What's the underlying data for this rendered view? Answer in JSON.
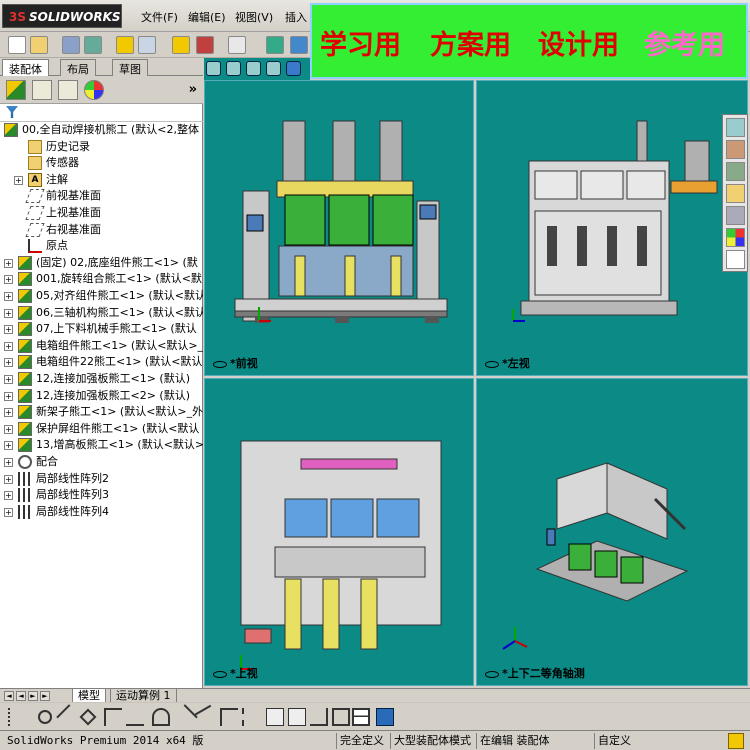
{
  "app": {
    "logo_text": "SOLIDWORKS",
    "menu": [
      "文件(F)",
      "编辑(E)",
      "视图(V)",
      "插入"
    ]
  },
  "banner": {
    "items": [
      {
        "text": "学习用",
        "color": "#e00000"
      },
      {
        "text": "方案用",
        "color": "#e00000"
      },
      {
        "text": "设计用",
        "color": "#e00000"
      },
      {
        "text": "参考用",
        "color": "#ff66cc"
      }
    ],
    "background": "#33ee33"
  },
  "panel": {
    "tabs": [
      "装配体",
      "布局",
      "草图"
    ],
    "active_tab": "装配体",
    "collapse_glyph": "»"
  },
  "tree": [
    {
      "label": "00,全自动焊接机熊工   (默认<2,整体",
      "icon": "assembly",
      "expander": false
    },
    {
      "label": "历史记录",
      "icon": "folder",
      "expander": false
    },
    {
      "label": "传感器",
      "icon": "folder",
      "expander": false
    },
    {
      "label": "注解",
      "icon": "note",
      "expander": true
    },
    {
      "label": "前视基准面",
      "icon": "plane",
      "expander": false
    },
    {
      "label": "上视基准面",
      "icon": "plane",
      "expander": false
    },
    {
      "label": "右视基准面",
      "icon": "plane",
      "expander": false
    },
    {
      "label": "原点",
      "icon": "origin",
      "expander": false
    },
    {
      "label": "(固定) 02,底座组件熊工<1> (默",
      "icon": "assembly",
      "expander": true
    },
    {
      "label": "001,旋转组合熊工<1> (默认<默",
      "icon": "assembly",
      "expander": true
    },
    {
      "label": "05,对齐组件熊工<1> (默认<默认>",
      "icon": "assembly",
      "expander": true
    },
    {
      "label": "06,三轴机构熊工<1> (默认<默认",
      "icon": "assembly",
      "expander": true
    },
    {
      "label": "07,上下料机械手熊工<1> (默认",
      "icon": "assembly",
      "expander": true
    },
    {
      "label": "电箱组件熊工<1> (默认<默认>_",
      "icon": "assembly",
      "expander": true
    },
    {
      "label": "电箱组件22熊工<1> (默认<默认",
      "icon": "assembly",
      "expander": true
    },
    {
      "label": "12,连接加强板熊工<1> (默认)",
      "icon": "assembly",
      "expander": true
    },
    {
      "label": "12,连接加强板熊工<2> (默认)",
      "icon": "assembly",
      "expander": true
    },
    {
      "label": "新架子熊工<1> (默认<默认>_外",
      "icon": "assembly",
      "expander": true
    },
    {
      "label": "保护屏组件熊工<1> (默认<默认",
      "icon": "assembly",
      "expander": true
    },
    {
      "label": "13,增高板熊工<1> (默认<默认>",
      "icon": "assembly",
      "expander": true
    },
    {
      "label": "配合",
      "icon": "mate",
      "expander": true
    },
    {
      "label": "局部线性阵列2",
      "icon": "pattern",
      "expander": true
    },
    {
      "label": "局部线性阵列3",
      "icon": "pattern",
      "expander": true
    },
    {
      "label": "局部线性阵列4",
      "icon": "pattern",
      "expander": true
    }
  ],
  "viewports": {
    "front": "*前视",
    "left": "*左视",
    "top": "*上视",
    "iso": "*上下二等角轴测"
  },
  "bottom_tabs": [
    "模型",
    "运动算例 1"
  ],
  "status": {
    "product": "SolidWorks Premium 2014 x64 版",
    "fully_defined": "完全定义",
    "large_assembly": "大型装配体模式",
    "editing": "在编辑 装配体",
    "custom": "自定义"
  },
  "colors": {
    "viewport_bg": "#0b8a86",
    "panel_bg": "#d4d0c8"
  }
}
